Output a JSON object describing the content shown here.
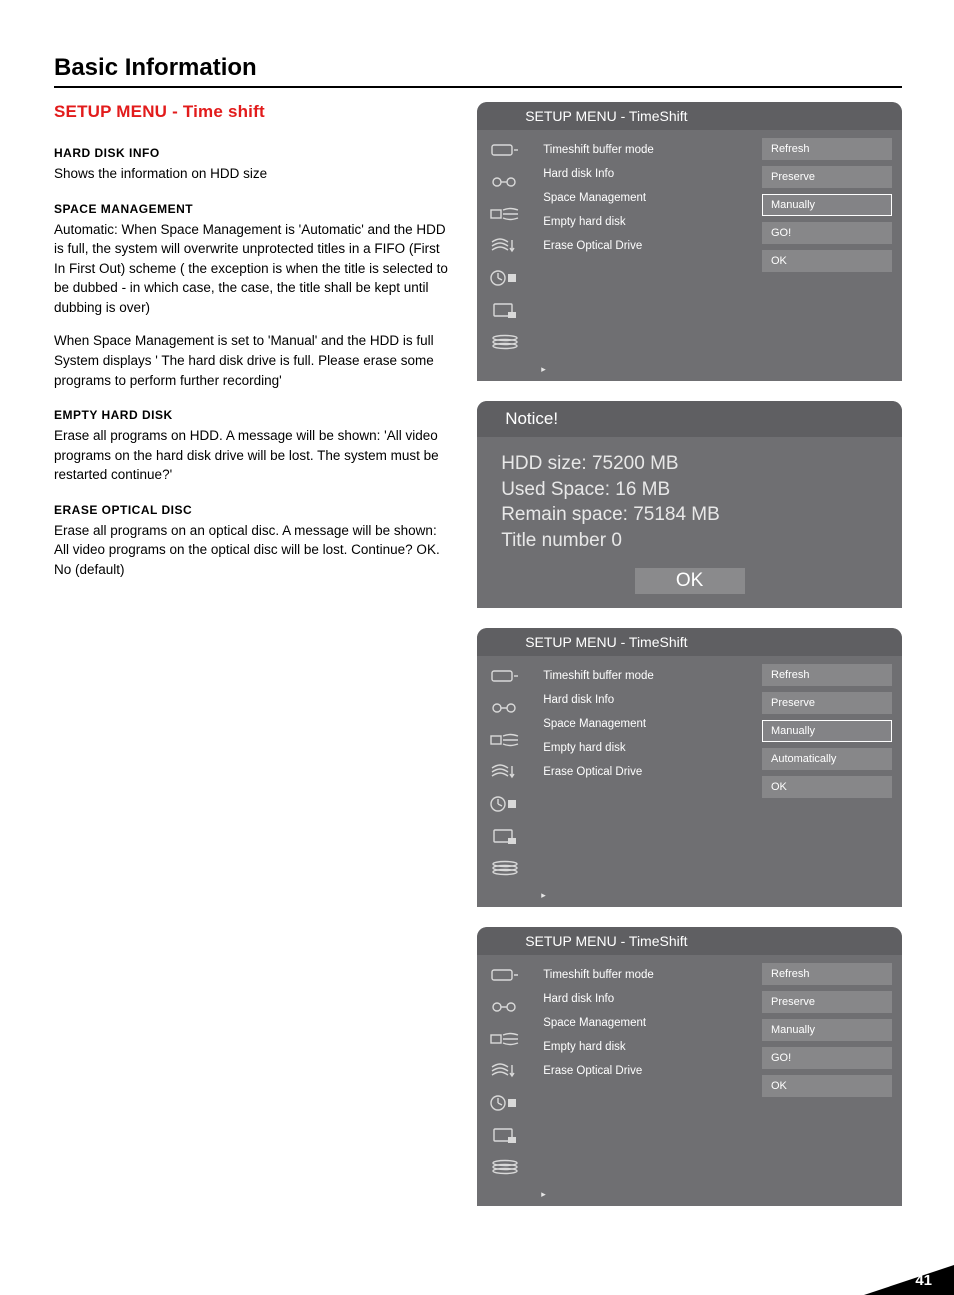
{
  "page_title": "Basic Information",
  "subtitle": "SETUP MENU - Time shift",
  "page_number": "41",
  "left": {
    "h1": "HARD DISK INFO",
    "p1": "Shows the information on HDD size",
    "h2": "SPACE MANAGEMENT",
    "p2": "Automatic: When Space Management is 'Automatic' and the HDD is full, the system will overwrite unprotected titles in a FIFO (First In First Out) scheme ( the exception is when the title is  selected to be dubbed - in which case, the case, the title shall be kept until dubbing is over)",
    "p3": "When Space Management is set to 'Manual' and the HDD is full System displays ' The hard disk drive is full. Please erase some programs to perform further recording'",
    "h3": "EMPTY HARD DISK",
    "p4": "Erase all programs on HDD. A message will be shown: 'All video programs on the hard disk drive will be lost. The system must be restarted continue?'",
    "h4": "ERASE OPTICAL DISC",
    "p5": "Erase all programs on an optical disc. A message will be shown: All video programs on the optical disc will be lost. Continue? OK. No (default)"
  },
  "panel_common": {
    "title": "SETUP MENU - TimeShift",
    "items": [
      "Timeshift buffer mode",
      "Hard disk Info",
      "Space Management",
      "Empty hard disk",
      "Erase Optical Drive"
    ],
    "playhint": "▸"
  },
  "panel1_values": [
    "Refresh",
    "Preserve",
    "Manually",
    "GO!",
    "OK"
  ],
  "panel1_selected": 2,
  "panel2_values": [
    "Refresh",
    "Preserve",
    "Manually",
    "Automatically",
    "OK"
  ],
  "panel2_selected": 2,
  "panel3_values": [
    "Refresh",
    "Preserve",
    "Manually",
    "GO!",
    "OK"
  ],
  "panel3_selected": -1,
  "notice": {
    "title": "Notice!",
    "l1": "HDD size: 75200 MB",
    "l2": "Used Space: 16 MB",
    "l3": "Remain space: 75184 MB",
    "l4": "Title number 0",
    "ok": "OK"
  }
}
